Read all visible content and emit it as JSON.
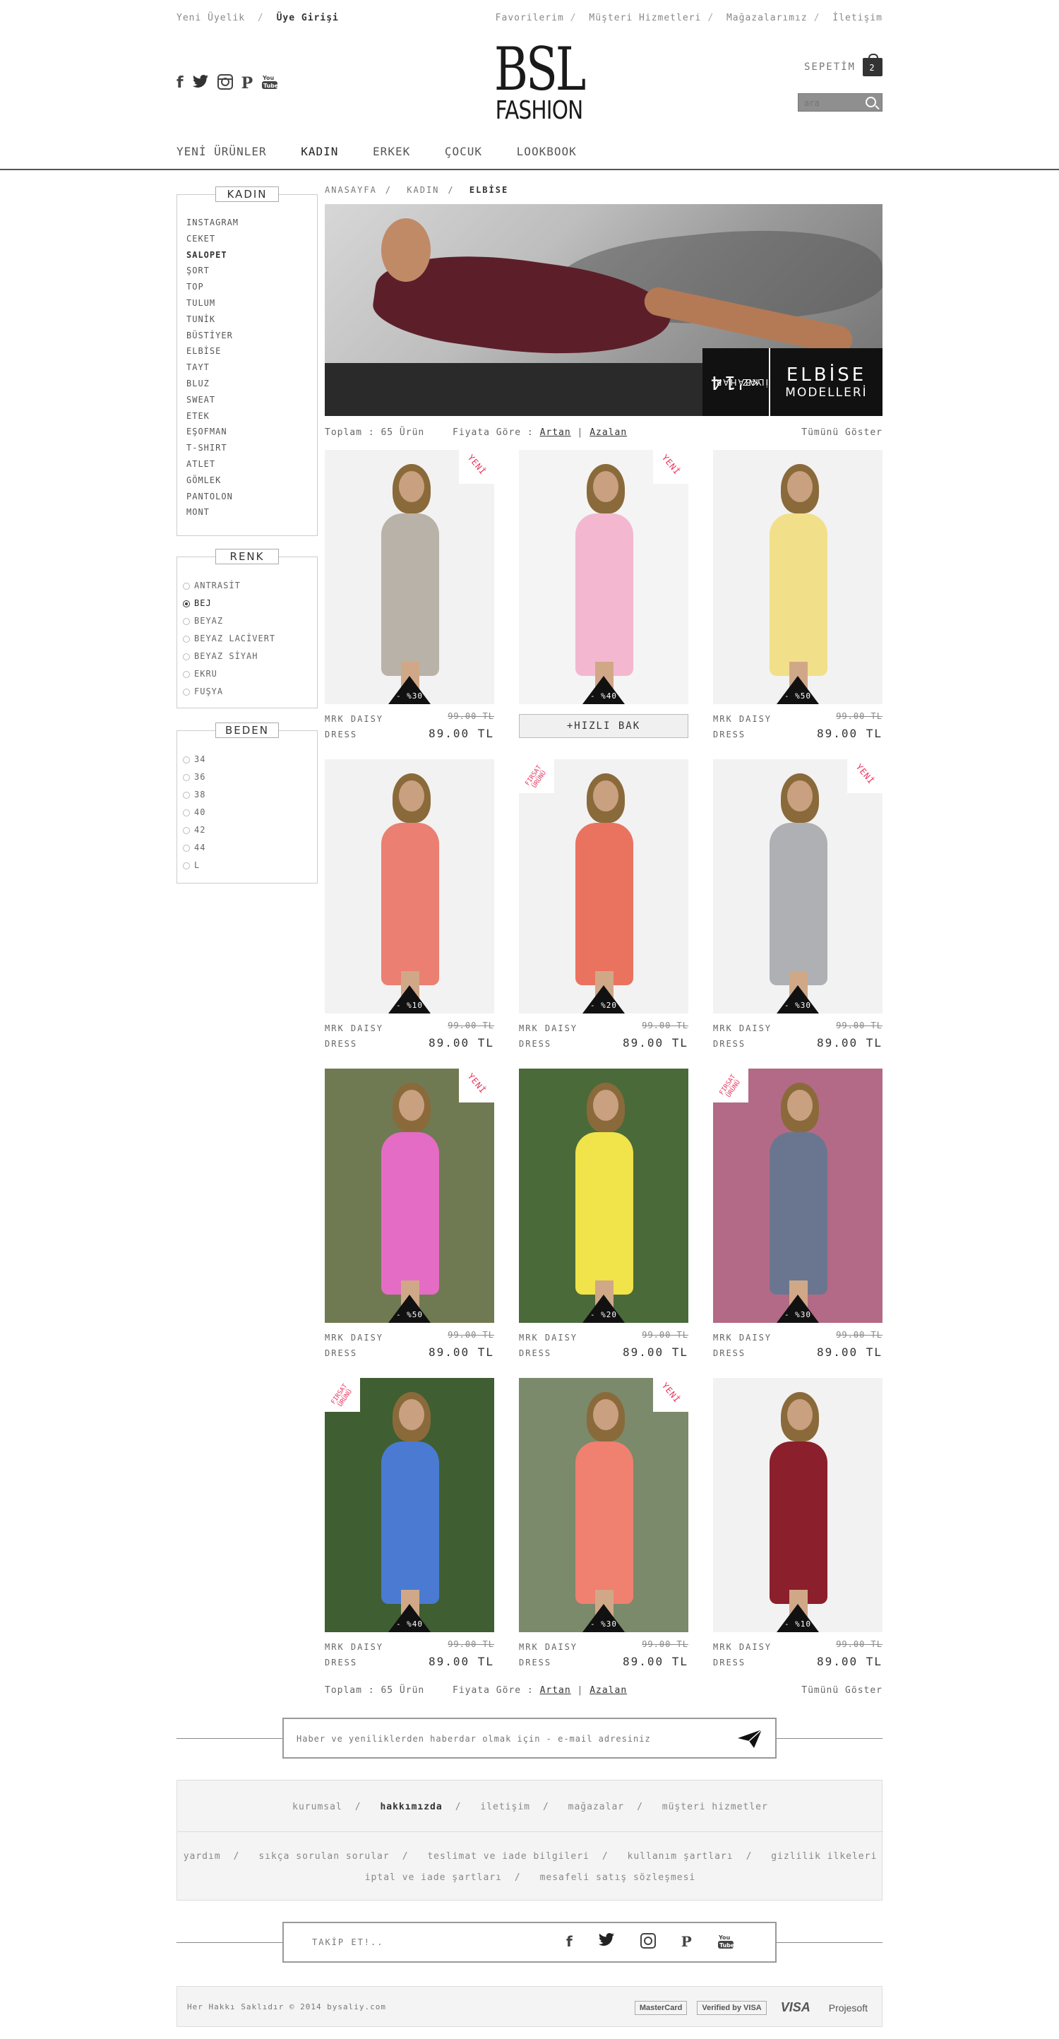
{
  "topbar": {
    "new_member": "Yeni Üyelik",
    "login": "Üye Girişi",
    "links": [
      "Favorilerim",
      "Müşteri Hizmetleri",
      "Mağazalarımız",
      "İletişim"
    ]
  },
  "header": {
    "logo_line1": "BSL",
    "logo_line2": "FASHION",
    "cart_label": "SEPETİM",
    "cart_count": "2",
    "search_placeholder": "ara",
    "social_icons": [
      "facebook-icon",
      "twitter-icon",
      "instagram-icon",
      "pinterest-icon",
      "youtube-icon"
    ]
  },
  "nav": [
    "YENİ ÜRÜNLER",
    "KADIN",
    "ERKEK",
    "ÇOCUK",
    "LOOKBOOK"
  ],
  "sidebar": {
    "category_title": "KADIN",
    "categories": [
      "INSTAGRAM",
      "CEKET",
      "SALOPET",
      "ŞORT",
      "TOP",
      "TULUM",
      "TUNİK",
      "BÜSTİYER",
      "ELBİSE",
      "TAYT",
      "BLUZ",
      "SWEAT",
      "ETEK",
      "EŞOFMAN",
      "T-SHIRT",
      "ATLET",
      "GÖMLEK",
      "PANTOLON",
      "MONT"
    ],
    "color_title": "RENK",
    "colors": [
      "ANTRASİT",
      "BEJ",
      "BEYAZ",
      "BEYAZ LACİVERT",
      "BEYAZ SİYAH",
      "EKRU",
      "FUŞYA"
    ],
    "selected_color": "BEJ",
    "size_title": "BEDEN",
    "sizes": [
      "34",
      "36",
      "38",
      "40",
      "42",
      "44",
      "L"
    ]
  },
  "breadcrumb": [
    "ANASAYFA",
    "KADIN",
    "ELBİSE"
  ],
  "banner": {
    "year": "'14",
    "season_a": "İLKBAHAR",
    "season_b": "YAZ",
    "title_a": "ELBİSE",
    "title_b": "MODELLERİ"
  },
  "sort": {
    "total": "Toplam : 65 Ürün",
    "by_price": "Fiyata Göre :",
    "asc": "Artan",
    "desc": "Azalan",
    "show_all": "Tümünü Göster"
  },
  "products": [
    {
      "name1": "MRK DAISY",
      "name2": "DRESS",
      "old": "99.00 TL",
      "price": "89.00 TL",
      "discount": "- %30",
      "tag": "YENİ",
      "dress_color": "#b9b2a8",
      "bg": "#f2f2f2",
      "quick": ""
    },
    {
      "name1": "",
      "name2": "",
      "old": "",
      "price": "",
      "discount": "- %40",
      "tag": "YENİ",
      "dress_color": "#f3b8cf",
      "bg": "#f4f4f4",
      "quick": "+HIZLI BAK"
    },
    {
      "name1": "MRK DAISY",
      "name2": "DRESS",
      "old": "99.00 TL",
      "price": "89.00 TL",
      "discount": "- %50",
      "tag": "",
      "dress_color": "#f2df8a",
      "bg": "#f2f2f2",
      "quick": ""
    },
    {
      "name1": "MRK DAISY",
      "name2": "DRESS",
      "old": "99.00 TL",
      "price": "89.00 TL",
      "discount": "- %10",
      "tag": "",
      "dress_color": "#ea7f72",
      "bg": "#f2f2f2",
      "quick": ""
    },
    {
      "name1": "MRK DAISY",
      "name2": "DRESS",
      "old": "99.00 TL",
      "price": "89.00 TL",
      "discount": "- %20",
      "tag": "FIRSAT ÜRÜNÜ",
      "dress_color": "#e9735e",
      "bg": "#f2f2f2",
      "quick": ""
    },
    {
      "name1": "MRK DAISY",
      "name2": "DRESS",
      "old": "99.00 TL",
      "price": "89.00 TL",
      "discount": "- %30",
      "tag": "YENİ",
      "dress_color": "#aeb0b3",
      "bg": "#f2f2f2",
      "quick": ""
    },
    {
      "name1": "MRK DAISY",
      "name2": "DRESS",
      "old": "99.00 TL",
      "price": "89.00 TL",
      "discount": "- %50",
      "tag": "YENİ",
      "dress_color": "#e56cc4",
      "bg": "#6f7a52",
      "quick": ""
    },
    {
      "name1": "MRK DAISY",
      "name2": "DRESS",
      "old": "99.00 TL",
      "price": "89.00 TL",
      "discount": "- %20",
      "tag": "",
      "dress_color": "#f1e34a",
      "bg": "#4a6a3a",
      "quick": ""
    },
    {
      "name1": "MRK DAISY",
      "name2": "DRESS",
      "old": "99.00 TL",
      "price": "89.00 TL",
      "discount": "- %30",
      "tag": "FIRSAT ÜRÜNÜ",
      "dress_color": "#6a7690",
      "bg": "#b36a86",
      "quick": ""
    },
    {
      "name1": "MRK DAISY",
      "name2": "DRESS",
      "old": "99.00 TL",
      "price": "89.00 TL",
      "discount": "- %40",
      "tag": "FIRSAT ÜRÜNÜ",
      "dress_color": "#4a7ad2",
      "bg": "#3f5e32",
      "quick": ""
    },
    {
      "name1": "MRK DAISY",
      "name2": "DRESS",
      "old": "99.00 TL",
      "price": "89.00 TL",
      "discount": "- %30",
      "tag": "YENİ",
      "dress_color": "#f08070",
      "bg": "#7a8a6a",
      "quick": ""
    },
    {
      "name1": "MRK DAISY",
      "name2": "DRESS",
      "old": "99.00 TL",
      "price": "89.00 TL",
      "discount": "- %10",
      "tag": "",
      "dress_color": "#8c1f2c",
      "bg": "#f2f2f2",
      "quick": ""
    }
  ],
  "newsletter": {
    "placeholder": "Haber ve yeniliklerden haberdar olmak için - e-mail adresiniz"
  },
  "footer": {
    "row1": [
      "kurumsal",
      "hakkımızda",
      "iletişim",
      "mağazalar",
      "müşteri hizmetler"
    ],
    "row2": [
      "yardım",
      "sıkça sorulan sorular",
      "teslimat ve iade bilgileri",
      "kullanım şartları",
      "gizlilik ilkeleri"
    ],
    "row3": [
      "iptal ve iade şartları",
      "mesafeli satış sözleşmesi"
    ],
    "follow": "TAKİP ET!..",
    "copyright": "Her Hakkı Saklıdır © 2014  bysaliy.com",
    "payments": [
      "MasterCard",
      "Verified by VISA",
      "VISA",
      "Projesoft"
    ]
  }
}
